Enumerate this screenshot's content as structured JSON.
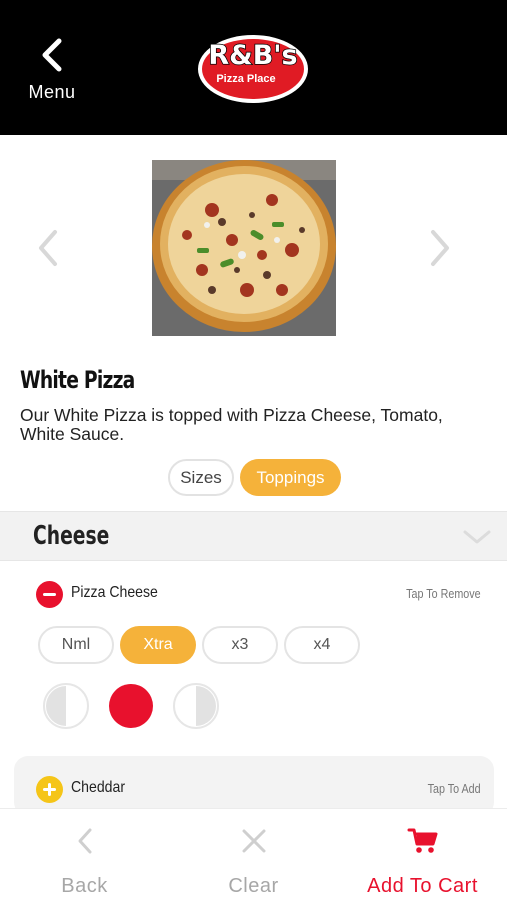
{
  "header": {
    "back_label": "Menu",
    "logo_main": "R&B's",
    "logo_sub": "Pizza Place"
  },
  "product": {
    "title": "White Pizza",
    "description": "Our White Pizza is topped with Pizza Cheese, Tomato, White Sauce."
  },
  "options_tabs": [
    {
      "label": "Sizes",
      "selected": false
    },
    {
      "label": "Toppings",
      "selected": true
    }
  ],
  "section": {
    "title": "Cheese"
  },
  "toppings": [
    {
      "name": "Pizza Cheese",
      "hint": "Tap To Remove",
      "selected": true,
      "quantities": [
        {
          "label": "Nml",
          "selected": false
        },
        {
          "label": "Xtra",
          "selected": true
        },
        {
          "label": "x3",
          "selected": false
        },
        {
          "label": "x4",
          "selected": false
        }
      ],
      "portion": "whole"
    },
    {
      "name": "Cheddar",
      "hint": "Tap To Add",
      "selected": false
    }
  ],
  "bottom_bar": {
    "back_label": "Back",
    "clear_label": "Clear",
    "add_label": "Add To Cart"
  },
  "colors": {
    "accent": "#f5b23a",
    "red": "#e8112d",
    "header_bg": "#000000"
  }
}
